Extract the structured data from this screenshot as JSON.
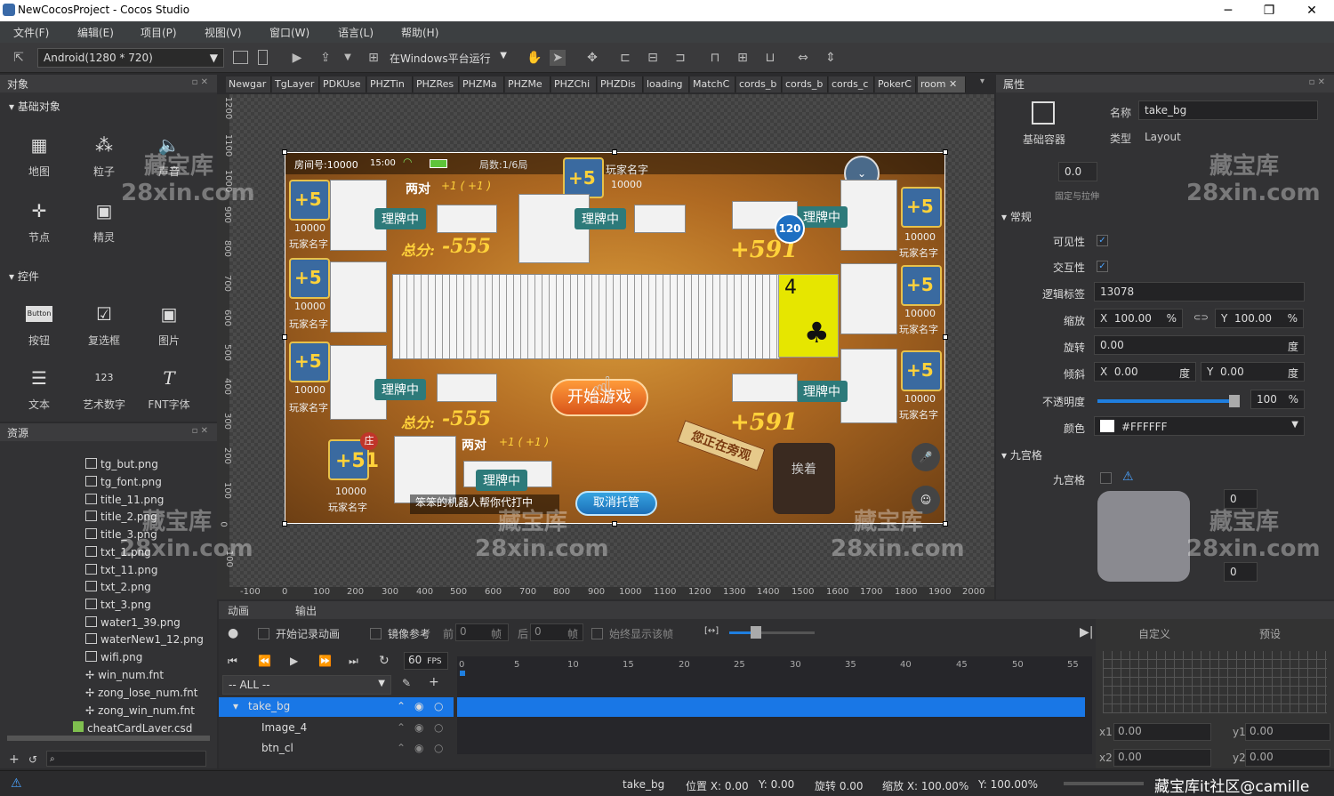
{
  "window": {
    "title": "NewCocosProject - Cocos Studio",
    "minimize": "─",
    "maximize": "❐",
    "close": "✕"
  },
  "menu": [
    "文件(F)",
    "编辑(E)",
    "项目(P)",
    "视图(V)",
    "窗口(W)",
    "语言(L)",
    "帮助(H)"
  ],
  "toolbar": {
    "resolution": "Android(1280 * 720)",
    "run_target": "在Windows平台运行"
  },
  "objects_panel": {
    "title": "对象",
    "basic_section": "基础对象",
    "basic_items": [
      "地图",
      "粒子",
      "声音",
      "节点",
      "精灵"
    ],
    "controls_section": "控件",
    "control_items": [
      "按钮",
      "复选框",
      "图片",
      "文本",
      "艺术数字",
      "FNT字体"
    ],
    "button_icon_text": "Button",
    "labelatlas_icon_text": "123"
  },
  "resources_panel": {
    "title": "资源",
    "files": [
      "tg_but.png",
      "tg_font.png",
      "title_11.png",
      "title_2.png",
      "title_3.png",
      "txt_1.png",
      "txt_11.png",
      "txt_2.png",
      "txt_3.png",
      "water1_39.png",
      "waterNew1_12.png",
      "wifi.png",
      "win_num.fnt",
      "zong_lose_num.fnt",
      "zong_win_num.fnt",
      "cheatCardLaver.csd"
    ]
  },
  "doc_tabs": [
    "Newgar",
    "TgLayer",
    "PDKUse",
    "PHZTin",
    "PHZRes",
    "PHZMa",
    "PHZMe",
    "PHZChi",
    "PHZDis",
    "loading",
    "MatchC",
    "cords_b",
    "cords_b",
    "cords_c",
    "PokerC",
    "room"
  ],
  "rulers": {
    "vertical": [
      "1200",
      "1100",
      "1000",
      "900",
      "800",
      "700",
      "600",
      "500",
      "400",
      "300",
      "200",
      "100",
      "0",
      "-100"
    ],
    "horizontal": [
      "-100",
      "0",
      "100",
      "200",
      "300",
      "400",
      "500",
      "600",
      "700",
      "800",
      "900",
      "1000",
      "1100",
      "1200",
      "1300",
      "1400",
      "1500",
      "1600",
      "1700",
      "1800",
      "1900",
      "2000"
    ]
  },
  "scene": {
    "room_no": "房间号:10000",
    "time": "15:00",
    "round": "局数:1/6局",
    "player_name": "玩家名字",
    "player_score": "10000",
    "pair_label": "两对",
    "pair_value": "+1 ( +1 )",
    "playing_label": "理牌中",
    "total_label": "总分:",
    "total_value": "-555",
    "total_win": "+591",
    "timer": "120",
    "big_card": "4",
    "start_button": "开始游戏",
    "banker_badge": "庄",
    "banker_score": "+51",
    "avatar_score": "+5",
    "watching_badge": "您正在旁观",
    "ready_badge": "挨着",
    "robot_notice": "笨笨的机器人帮你代打中",
    "cancel_trust": "取消托管"
  },
  "props": {
    "title": "属性",
    "container_label": "基础容器",
    "name_label": "名称",
    "name_value": "take_bg",
    "type_label": "类型",
    "type_value": "Layout",
    "stretch_value": "0.0",
    "stretch_label": "固定与拉伸",
    "general_section": "常规",
    "visible_label": "可见性",
    "interactive_label": "交互性",
    "tag_label": "逻辑标签",
    "tag_value": "13078",
    "scale_label": "缩放",
    "scale_x": "100.00",
    "scale_y": "100.00",
    "rotation_label": "旋转",
    "rotation_value": "0.00",
    "skew_label": "倾斜",
    "skew_x": "0.00",
    "skew_y": "0.00",
    "opacity_label": "不透明度",
    "opacity_value": "100",
    "color_label": "颜色",
    "color_value": "#FFFFFF",
    "nine_section": "九宫格",
    "nine_label": "九宫格",
    "nine_top": "0",
    "nine_bottom": "0",
    "x": "X",
    "y": "Y",
    "pct": "%",
    "deg": "度"
  },
  "timeline": {
    "tabs": [
      "动画",
      "输出"
    ],
    "record": "开始记录动画",
    "mirror": "镜像参考",
    "before": "前",
    "before_val": "0",
    "frame": "帧",
    "after": "后",
    "after_val": "0",
    "always_show": "始终显示该帧",
    "fps_value": "60",
    "fps_label": "FPS",
    "filter": "-- ALL --",
    "tracks": [
      "take_bg",
      "Image_4",
      "btn_cl"
    ],
    "ticks": [
      "0",
      "5",
      "10",
      "15",
      "20",
      "25",
      "30",
      "35",
      "40",
      "45",
      "50",
      "55"
    ],
    "custom_tab": "自定义",
    "preset_tab": "预设",
    "x1": "x1",
    "x1_val": "0.00",
    "y1": "y1",
    "y1_val": "0.00",
    "x2": "x2",
    "x2_val": "0.00",
    "y2": "y2",
    "y2_val": "0.00"
  },
  "status": {
    "node": "take_bg",
    "pos_label": "位置 X: 0.00",
    "pos_y": "Y: 0.00",
    "rot": "旋转 0.00",
    "scale_label": "缩放 X: 100.00%",
    "scale_y": "Y: 100.00%"
  },
  "watermark": {
    "line1": "藏宝库",
    "line2": "28xin.com",
    "corner": "藏宝库it社区@camille"
  },
  "colors": {
    "accent": "#1f7fe0",
    "timeline_selected": "#1977e6",
    "scene_bg": "#b06a22",
    "score_gold": "#ffd23a"
  }
}
